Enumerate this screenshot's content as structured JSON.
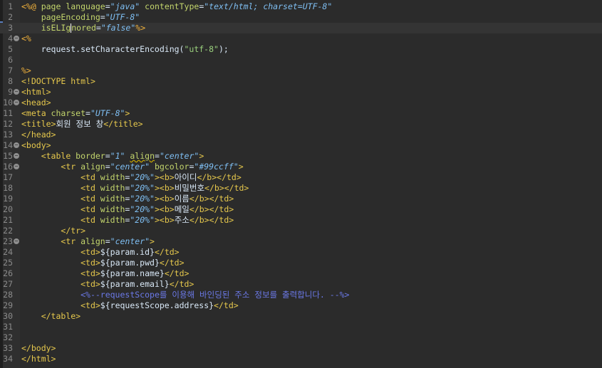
{
  "editor": {
    "lines": [
      {
        "num": "1",
        "current": false,
        "fold": false,
        "tokens": [
          [
            "amb",
            "<%@ "
          ],
          [
            "attr",
            "page "
          ],
          [
            "attr",
            "language"
          ],
          [
            "txt",
            "="
          ],
          [
            "val",
            "\"java\""
          ],
          [
            "txt",
            " "
          ],
          [
            "attr",
            "contentType"
          ],
          [
            "txt",
            "="
          ],
          [
            "val",
            "\"text/html; charset=UTF-8\""
          ]
        ]
      },
      {
        "num": "2",
        "current": false,
        "fold": false,
        "tokens": [
          [
            "txt",
            "    "
          ],
          [
            "attr",
            "pageEncoding"
          ],
          [
            "txt",
            "="
          ],
          [
            "val",
            "\"UTF-8\""
          ]
        ]
      },
      {
        "num": "3",
        "current": true,
        "fold": false,
        "tokens": [
          [
            "txt",
            "    "
          ],
          [
            "attr",
            "isELIg"
          ],
          [
            "caret",
            ""
          ],
          [
            "attr",
            "nored"
          ],
          [
            "txt",
            "="
          ],
          [
            "val",
            "\"false\""
          ],
          [
            "amb",
            "%>"
          ]
        ]
      },
      {
        "num": "4",
        "current": false,
        "fold": true,
        "tokens": [
          [
            "amb",
            "<%"
          ]
        ]
      },
      {
        "num": "5",
        "current": false,
        "fold": false,
        "tokens": [
          [
            "txt",
            "    request.setCharacterEncoding("
          ],
          [
            "sq",
            "\"utf-8\""
          ],
          [
            "txt",
            ");"
          ]
        ]
      },
      {
        "num": "6",
        "current": false,
        "fold": false,
        "tokens": []
      },
      {
        "num": "7",
        "current": false,
        "fold": false,
        "tokens": [
          [
            "amb",
            "%>"
          ]
        ]
      },
      {
        "num": "8",
        "current": false,
        "fold": false,
        "tokens": [
          [
            "tag",
            "<!DOCTYPE "
          ],
          [
            "tag",
            "html"
          ],
          [
            "tag",
            ">"
          ]
        ]
      },
      {
        "num": "9",
        "current": false,
        "fold": true,
        "tokens": [
          [
            "tag",
            "<html>"
          ]
        ]
      },
      {
        "num": "10",
        "current": false,
        "fold": true,
        "tokens": [
          [
            "tag",
            "<head>"
          ]
        ]
      },
      {
        "num": "11",
        "current": false,
        "fold": false,
        "tokens": [
          [
            "tag",
            "<meta "
          ],
          [
            "attr",
            "charset"
          ],
          [
            "txt",
            "="
          ],
          [
            "val",
            "\"UTF-8\""
          ],
          [
            "tag",
            ">"
          ]
        ]
      },
      {
        "num": "12",
        "current": false,
        "fold": false,
        "tokens": [
          [
            "tag",
            "<title>"
          ],
          [
            "txt",
            "회원 정보 창"
          ],
          [
            "tag",
            "</title>"
          ]
        ]
      },
      {
        "num": "13",
        "current": false,
        "fold": false,
        "tokens": [
          [
            "tag",
            "</head>"
          ]
        ]
      },
      {
        "num": "14",
        "current": false,
        "fold": true,
        "tokens": [
          [
            "tag",
            "<body>"
          ]
        ]
      },
      {
        "num": "15",
        "current": false,
        "fold": true,
        "tokens": [
          [
            "txt",
            "    "
          ],
          [
            "tag",
            "<table "
          ],
          [
            "attr",
            "border"
          ],
          [
            "txt",
            "="
          ],
          [
            "val",
            "\"1\""
          ],
          [
            "txt",
            " "
          ],
          [
            "warn",
            "align"
          ],
          [
            "txt",
            "="
          ],
          [
            "val",
            "\"center\""
          ],
          [
            "tag",
            ">"
          ]
        ]
      },
      {
        "num": "16",
        "current": false,
        "fold": true,
        "tokens": [
          [
            "txt",
            "        "
          ],
          [
            "tag",
            "<tr "
          ],
          [
            "attr",
            "align"
          ],
          [
            "txt",
            "="
          ],
          [
            "val",
            "\"center\""
          ],
          [
            "txt",
            " "
          ],
          [
            "attr",
            "bgcolor"
          ],
          [
            "txt",
            "="
          ],
          [
            "val",
            "\"#99ccff\""
          ],
          [
            "tag",
            ">"
          ]
        ]
      },
      {
        "num": "17",
        "current": false,
        "fold": false,
        "tokens": [
          [
            "txt",
            "            "
          ],
          [
            "tag",
            "<td "
          ],
          [
            "attr",
            "width"
          ],
          [
            "txt",
            "="
          ],
          [
            "val",
            "\"20%\""
          ],
          [
            "tag",
            ">"
          ],
          [
            "tag",
            "<b>"
          ],
          [
            "txt",
            "아이디"
          ],
          [
            "tag",
            "</b>"
          ],
          [
            "tag",
            "</td>"
          ]
        ]
      },
      {
        "num": "18",
        "current": false,
        "fold": false,
        "tokens": [
          [
            "txt",
            "            "
          ],
          [
            "tag",
            "<td "
          ],
          [
            "attr",
            "width"
          ],
          [
            "txt",
            "="
          ],
          [
            "val",
            "\"20%\""
          ],
          [
            "tag",
            ">"
          ],
          [
            "tag",
            "<b>"
          ],
          [
            "txt",
            "비밀번호"
          ],
          [
            "tag",
            "</b>"
          ],
          [
            "tag",
            "</td>"
          ]
        ]
      },
      {
        "num": "19",
        "current": false,
        "fold": false,
        "tokens": [
          [
            "txt",
            "            "
          ],
          [
            "tag",
            "<td "
          ],
          [
            "attr",
            "width"
          ],
          [
            "txt",
            "="
          ],
          [
            "val",
            "\"20%\""
          ],
          [
            "tag",
            ">"
          ],
          [
            "tag",
            "<b>"
          ],
          [
            "txt",
            "이름"
          ],
          [
            "tag",
            "</b>"
          ],
          [
            "tag",
            "</td>"
          ]
        ]
      },
      {
        "num": "20",
        "current": false,
        "fold": false,
        "tokens": [
          [
            "txt",
            "            "
          ],
          [
            "tag",
            "<td "
          ],
          [
            "attr",
            "width"
          ],
          [
            "txt",
            "="
          ],
          [
            "val",
            "\"20%\""
          ],
          [
            "tag",
            ">"
          ],
          [
            "tag",
            "<b>"
          ],
          [
            "txt",
            "메일"
          ],
          [
            "tag",
            "</b>"
          ],
          [
            "tag",
            "</td>"
          ]
        ]
      },
      {
        "num": "21",
        "current": false,
        "fold": false,
        "tokens": [
          [
            "txt",
            "            "
          ],
          [
            "tag",
            "<td "
          ],
          [
            "attr",
            "width"
          ],
          [
            "txt",
            "="
          ],
          [
            "val",
            "\"20%\""
          ],
          [
            "tag",
            ">"
          ],
          [
            "tag",
            "<b>"
          ],
          [
            "txt",
            "주소"
          ],
          [
            "tag",
            "</b>"
          ],
          [
            "tag",
            "</td>"
          ]
        ]
      },
      {
        "num": "22",
        "current": false,
        "fold": false,
        "tokens": [
          [
            "txt",
            "        "
          ],
          [
            "tag",
            "</tr>"
          ]
        ]
      },
      {
        "num": "23",
        "current": false,
        "fold": true,
        "tokens": [
          [
            "txt",
            "        "
          ],
          [
            "tag",
            "<tr "
          ],
          [
            "attr",
            "align"
          ],
          [
            "txt",
            "="
          ],
          [
            "val",
            "\"center\""
          ],
          [
            "tag",
            ">"
          ]
        ]
      },
      {
        "num": "24",
        "current": false,
        "fold": false,
        "tokens": [
          [
            "txt",
            "            "
          ],
          [
            "tag",
            "<td>"
          ],
          [
            "txt",
            "${param.id}"
          ],
          [
            "tag",
            "</td>"
          ]
        ]
      },
      {
        "num": "25",
        "current": false,
        "fold": false,
        "tokens": [
          [
            "txt",
            "            "
          ],
          [
            "tag",
            "<td>"
          ],
          [
            "txt",
            "${param.pwd}"
          ],
          [
            "tag",
            "</td>"
          ]
        ]
      },
      {
        "num": "26",
        "current": false,
        "fold": false,
        "tokens": [
          [
            "txt",
            "            "
          ],
          [
            "tag",
            "<td>"
          ],
          [
            "txt",
            "${param.name}"
          ],
          [
            "tag",
            "</td>"
          ]
        ]
      },
      {
        "num": "27",
        "current": false,
        "fold": false,
        "tokens": [
          [
            "txt",
            "            "
          ],
          [
            "tag",
            "<td>"
          ],
          [
            "txt",
            "${param.email}"
          ],
          [
            "tag",
            "</td>"
          ]
        ]
      },
      {
        "num": "28",
        "current": false,
        "fold": false,
        "tokens": [
          [
            "txt",
            "            "
          ],
          [
            "cmt",
            "<%--requestScope를 이용해 바인딩된 주소 정보를 출력합니다. --%>"
          ]
        ]
      },
      {
        "num": "29",
        "current": false,
        "fold": false,
        "tokens": [
          [
            "txt",
            "            "
          ],
          [
            "tag",
            "<td>"
          ],
          [
            "txt",
            "${requestScope.address}"
          ],
          [
            "tag",
            "</td>"
          ]
        ]
      },
      {
        "num": "30",
        "current": false,
        "fold": false,
        "tokens": [
          [
            "txt",
            "    "
          ],
          [
            "tag",
            "</table>"
          ]
        ]
      },
      {
        "num": "31",
        "current": false,
        "fold": false,
        "tokens": []
      },
      {
        "num": "32",
        "current": false,
        "fold": false,
        "tokens": []
      },
      {
        "num": "33",
        "current": false,
        "fold": false,
        "tokens": [
          [
            "tag",
            "</body>"
          ]
        ]
      },
      {
        "num": "34",
        "current": false,
        "fold": false,
        "tokens": [
          [
            "tag",
            "</html>"
          ]
        ]
      }
    ]
  }
}
